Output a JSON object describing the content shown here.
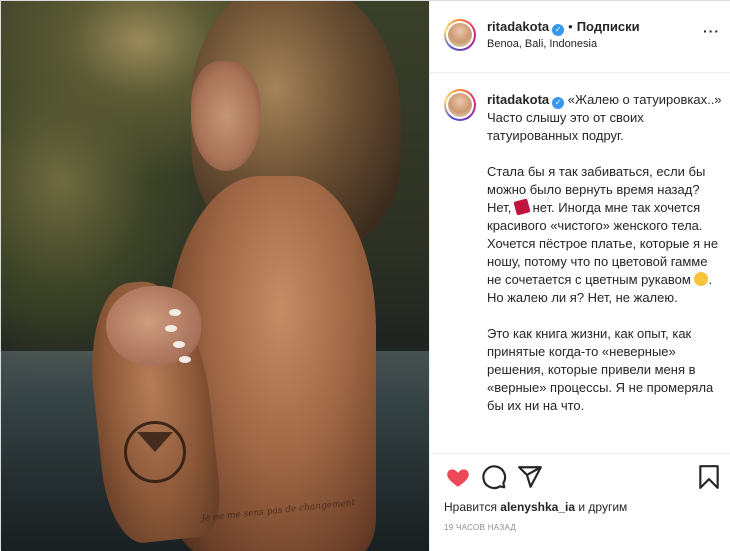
{
  "post": {
    "username": "ritadakota",
    "follow_label": "Подписки",
    "location": "Benoa, Bali, Indonesia",
    "more_label": "···",
    "photo_script_text": "Je ne me sens pas de changement"
  },
  "caption": {
    "username": "ritadakota",
    "paragraph_1": "«Жалею о татуировках..» Часто слышу это от своих татуированных подруг.",
    "paragraph_2_a": "Стала бы я так забиваться, если бы можно было вернуть время назад? Нет,",
    "paragraph_2_b": "нет. Иногда мне так хочется красивого «чистого» женского тела. Хочется пёстрое платье, которые я не ношу, потому что по цветовой гамме не сочетается с цветным рукавом",
    "paragraph_2_c": ". Но жалею ли я? Нет, не жалею.",
    "paragraph_3": "Это как книга жизни, как опыт, как принятые когда-то «неверные» решения, которые привели меня в «верные» процессы. Я не промеряла бы их ни на что."
  },
  "actions": {
    "heart": "heart-icon",
    "comment": "comment-icon",
    "share": "share-icon",
    "save": "bookmark-icon"
  },
  "likes": {
    "prefix": "Нравится",
    "user": "alenyshka_ia",
    "suffix": "и другим"
  },
  "timestamp": "19 часов назад",
  "colors": {
    "like_red": "#ed4956",
    "verified_blue": "#3897f0",
    "muted": "#8e8e8e"
  }
}
